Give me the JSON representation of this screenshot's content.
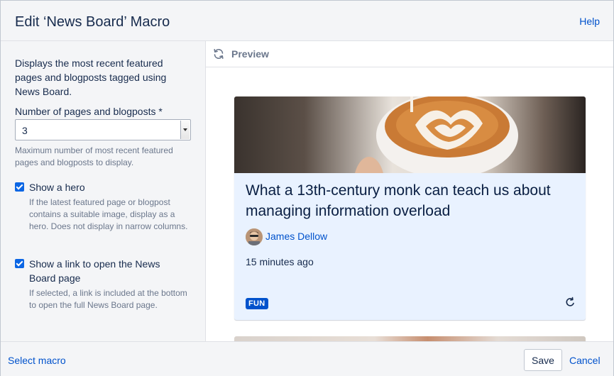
{
  "header": {
    "title": "Edit ‘News Board’ Macro",
    "help_label": "Help"
  },
  "settings": {
    "description": "Displays the most recent featured pages and blogposts tagged using News Board.",
    "count_field": {
      "label": "Number of pages and blogposts *",
      "value": "3",
      "hint": "Maximum number of most recent featured pages and blogposts to display."
    },
    "show_hero": {
      "label": "Show a hero",
      "checked": true,
      "hint": "If the latest featured page or blogpost contains a suitable image, display as a hero. Does not display in narrow columns."
    },
    "show_link": {
      "label_line1": "Show a link to open the News",
      "label_line2": "Board page",
      "checked": true,
      "hint": "If selected, a link is included at the bottom to open the full News Board page."
    }
  },
  "preview": {
    "label": "Preview",
    "icon": "refresh-icon",
    "card": {
      "title": "What a 13th-century monk can teach us about managing information overload",
      "author": "James Dellow",
      "timestamp": "15 minutes ago",
      "tag": "FUN",
      "action_icon": "loop-icon"
    }
  },
  "footer": {
    "select_macro_label": "Select macro",
    "save_label": "Save",
    "cancel_label": "Cancel"
  },
  "colors": {
    "accent": "#0052cc",
    "checkbox": "#0c66e4",
    "card_background": "#e9f2ff",
    "panel_background": "#f4f5f7"
  }
}
